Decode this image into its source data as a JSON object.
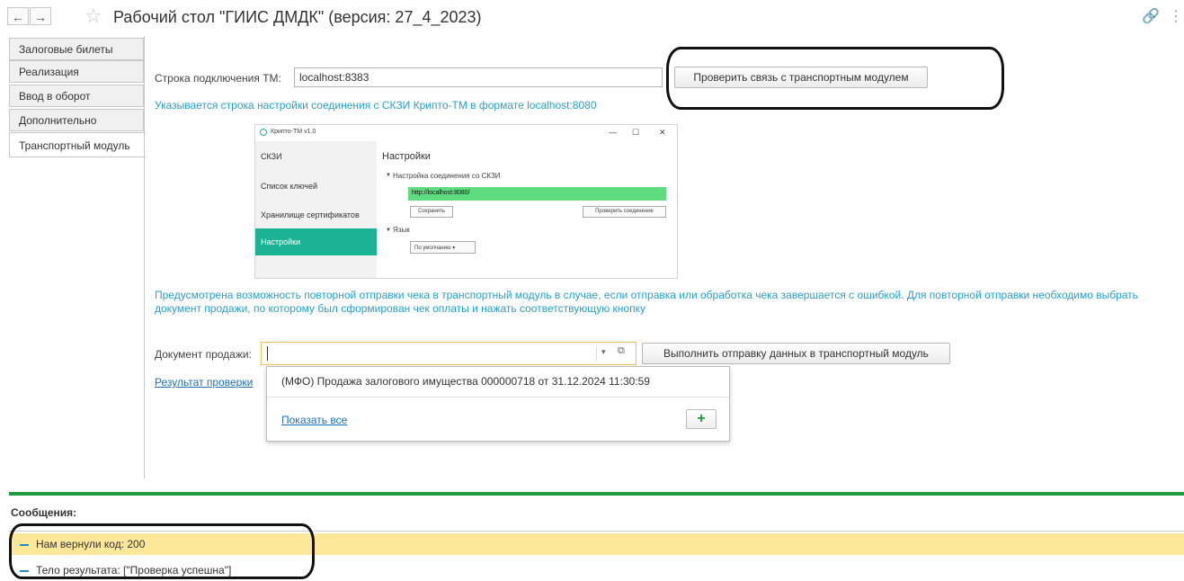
{
  "header": {
    "back": "←",
    "forward": "→",
    "star": "☆",
    "title": "Рабочий стол \"ГИИС ДМДК\" (версия: 27_4_2023)",
    "link_icon": "link-icon",
    "more_icon": "more-icon"
  },
  "tabs": [
    {
      "label": "Залоговые билеты"
    },
    {
      "label": "Реализация"
    },
    {
      "label": "Ввод в оборот"
    },
    {
      "label": "Дополнительно"
    },
    {
      "label": "Транспортный модуль",
      "active": true
    }
  ],
  "main": {
    "conn_label": "Строка подключения ТМ:",
    "conn_value": "localhost:8383",
    "check_button": "Проверить связь с транспортным модулем",
    "hint1": "Указывается строка настройки соединения с СКЗИ Крипто-ТМ в формате localhost:8080",
    "hint2": "Предусмотрена возможность повторной  отправки чека в транспортный модуль в случае, если отправка или обработка чека завершается с ошибкой. Для повторной отправки  необходимо выбрать документ продажи, по которому был сформирован чек оплаты и нажать соответствующую кнопку",
    "doc_label": "Документ продажи:",
    "doc_value": "",
    "send_button": "Выполнить отправку данных в транспортный модуль",
    "result_link": "Результат проверки"
  },
  "screenshot": {
    "app_title": "Крипто-ТМ v1.0",
    "win_min": "—",
    "win_max": "☐",
    "win_close": "✕",
    "side_items": [
      "СКЗИ",
      "Список ключей",
      "Хранилище сертификатов",
      "Настройки"
    ],
    "heading": "Настройки",
    "section1": "Настройка соединения со СКЗИ",
    "url": "http://localhost:8080/",
    "save": "Сохранить",
    "check": "Проверить соединение",
    "section2": "Язык",
    "lang": "По умолчанию"
  },
  "dropdown": {
    "item": "(МФО) Продажа залогового имущества 000000718 от 31.12.2024 11:30:59",
    "show_all": "Показать все",
    "add": "+"
  },
  "messages": {
    "title": "Сообщения:",
    "items": [
      {
        "text": "Нам вернули код: 200",
        "highlight": true
      },
      {
        "text": "Тело результата: [\"Проверка успешна\"]",
        "highlight": false
      }
    ]
  },
  "colors": {
    "hint": "#2aa0c8",
    "accent_green": "#1f9a3c",
    "selected_teal": "#1ab394",
    "highlight_yellow": "#fde89a"
  }
}
